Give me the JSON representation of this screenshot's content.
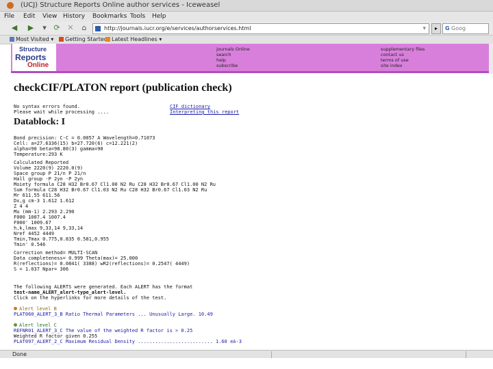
{
  "window": {
    "title": "(UCJ) Structure Reports Online author services - Iceweasel"
  },
  "menu": [
    "File",
    "Edit",
    "View",
    "History",
    "Bookmarks",
    "Tools",
    "Help"
  ],
  "navbar": {
    "url": "http://journals.iucr.org/e/services/authorservices.html",
    "search_placeholder": "Goog"
  },
  "bookmarks": [
    "Most Visited ▾",
    "Getting Started",
    "Latest Headlines ▾"
  ],
  "banner": {
    "logo": [
      "Structure",
      "Reports",
      "Online"
    ],
    "nav_left": [
      "journals Online",
      "search",
      "help",
      "subscribe"
    ],
    "nav_right": [
      "supplementary files",
      "contact us",
      "terms of use",
      "site index"
    ]
  },
  "report": {
    "title": "checkCIF/PLATON report (publication check)",
    "intro1": "No syntax errors found.",
    "intro2": "Please wait while processing ....",
    "link1": "CIF dictionary",
    "link2": "Interpreting this report",
    "datablock": "Datablock: I",
    "cell_lines": [
      "Bond precision:        C-C = 0.0057 A              Wavelength=0.71073",
      "Cell:        a=27.6336(15)     b=27.720(6)       c=12.221(2)",
      "             alpha=90          beta=98.80(3)     gamma=90",
      "Temperature:293 K"
    ],
    "table_header": "               Calculated                         Reported",
    "table_rows": [
      "Volume         2220(9)                            2220.0(9)",
      "Space group    P 21/n                             P 21/n",
      "Hall group     -P 2yn                             -P 2yn",
      "Moiety formula C28 H32 Br0.67 Cl1.00 N2 Ru        C28 H32 Br0.67 Cl1.00 N2 Ru",
      "Sum formula    C28 H32 Br0.67 Cl1.03 N2 Ru        C28 H32 Br0.67 Cl1.03 N2 Ru",
      "Mr             611.55                             611.56",
      "Dx,g cm-3      1.612                              1.612",
      "Z              4                                  4",
      "Mu (mm-1)      2.293                              2.290",
      "F000           1007.4                             1007.4",
      "F000'          1009.67",
      "h,k,lmax       9,33,14                            9,33,14",
      "Nref           4452                               4449",
      "Tmin,Tmax      0.775,0.835                        0.581,0.955",
      "Tmin'          0.546"
    ],
    "correction": "Correction method= MULTI-SCAN",
    "data_lines": [
      "Data completeness= 0.999          Theta(max)= 25.000",
      "R(reflections)= 0.0841( 3388)      wR2(reflections)= 0.2547( 4449)",
      "S = 1.037              Npar= 306"
    ],
    "alerts_intro": [
      "The following ALERTS were generated. Each ALERT has the format",
      "     test-name_ALERT_alert-type_alert-level.",
      "Click on the hyperlinks for more details of the test."
    ],
    "alert_b_label": "Alert level B",
    "alert_b_line": "PLAT060_ALERT_3_B Ratio Thermal Parameters ... Unusually Large.        10.49",
    "alert_c_label": "Alert level C",
    "alert_c_lines": [
      "REFNR01_ALERT_3_C The value of the weighted R factor is > 0.25",
      "           Weighted R factor given    0.255",
      "PLAT097_ALERT_2_C Maximum Residual Density ..........................  1.60 eA-3"
    ]
  },
  "status": {
    "text": "Done"
  }
}
